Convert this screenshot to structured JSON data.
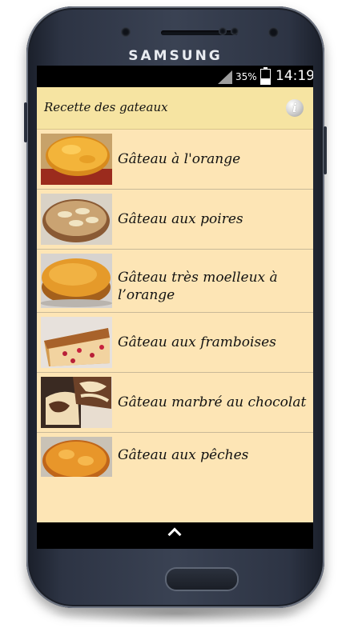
{
  "device": {
    "brand": "SAMSUNG"
  },
  "status_bar": {
    "battery_percent": "35%",
    "time": "14:19"
  },
  "app": {
    "title": "Recette des gateaux",
    "info_icon": "info-icon"
  },
  "recipes": [
    {
      "label": "Gâteau à l'orange"
    },
    {
      "label": "Gâteau aux poires"
    },
    {
      "label": "Gâteau très moelleux à l’orange"
    },
    {
      "label": "Gâteau aux framboises"
    },
    {
      "label": "Gâteau marbré au chocolat"
    },
    {
      "label": "Gâteau aux pêches"
    }
  ],
  "nav_bar": {
    "icon": "chevron-up-icon"
  }
}
